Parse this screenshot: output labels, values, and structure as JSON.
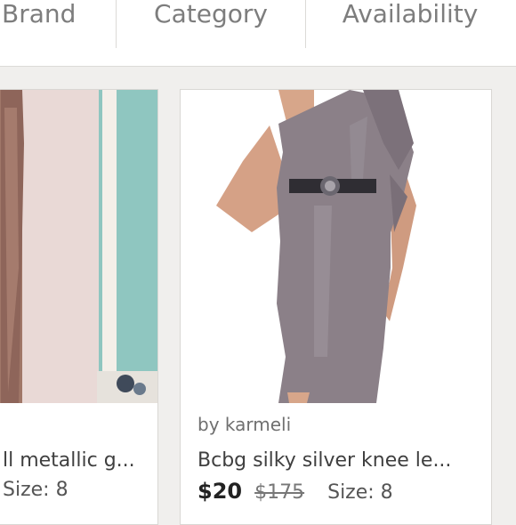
{
  "filters": {
    "brand": "Brand",
    "category": "Category",
    "availability": "Availability"
  },
  "listings": [
    {
      "title": "ll metallic g...",
      "size": "Size: 8"
    },
    {
      "seller": "by karmeli",
      "title": "Bcbg silky silver knee le...",
      "price": "$20",
      "original_price": "$175",
      "size": "Size: 8"
    }
  ],
  "colors": {
    "wall_pink": "#e7d6d3",
    "wall_teal": "#88c2bd",
    "dress_gray": "#8b8088",
    "gown_bronze": "#9d7467"
  }
}
